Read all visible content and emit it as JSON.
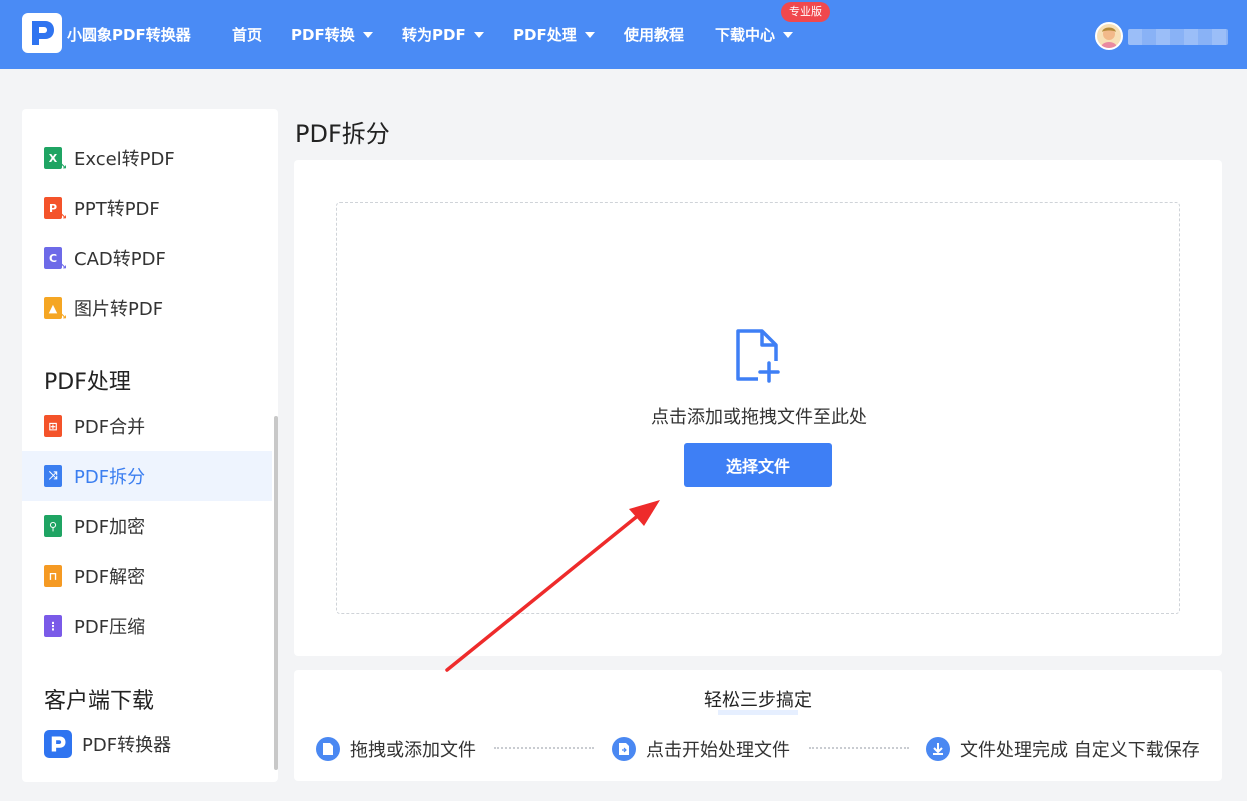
{
  "header": {
    "app_name": "小圆象PDF转换器",
    "nav": [
      "首页",
      "PDF转换",
      "转为PDF",
      "PDF处理",
      "使用教程",
      "下载中心"
    ],
    "pro_badge": "专业版",
    "bg_color": "#4a8bf5"
  },
  "sidebar": {
    "convert_items": [
      {
        "label": "Excel转PDF",
        "icon": "excel-icon",
        "icon_letter": "X",
        "color": "#1fa463"
      },
      {
        "label": "PPT转PDF",
        "icon": "ppt-icon",
        "icon_letter": "P",
        "color": "#f4532a"
      },
      {
        "label": "CAD转PDF",
        "icon": "cad-icon",
        "icon_letter": "C",
        "color": "#6d6ae8"
      },
      {
        "label": "图片转PDF",
        "icon": "image-icon",
        "icon_letter": "",
        "color": "#f5a623"
      }
    ],
    "pdf_section_title": "PDF处理",
    "pdf_items": [
      {
        "label": "PDF合并",
        "icon": "merge-icon",
        "color": "#f4532a"
      },
      {
        "label": "PDF拆分",
        "icon": "split-icon",
        "color": "#3b7ef0",
        "active": true
      },
      {
        "label": "PDF加密",
        "icon": "encrypt-icon",
        "color": "#1fa463"
      },
      {
        "label": "PDF解密",
        "icon": "decrypt-icon",
        "color": "#f59a23"
      },
      {
        "label": "PDF压缩",
        "icon": "compress-icon",
        "color": "#7a5ae8"
      }
    ],
    "client_section_title": "客户端下载",
    "client_item": {
      "label": "PDF转换器",
      "icon": "app-logo-icon"
    }
  },
  "main": {
    "title": "PDF拆分",
    "drop_hint": "点击添加或拖拽文件至此处",
    "select_button": "选择文件",
    "accent_color": "#3e7ff5"
  },
  "steps": {
    "title": "轻松三步搞定",
    "items": [
      {
        "label": "拖拽或添加文件",
        "icon": "file-icon"
      },
      {
        "label": "点击开始处理文件",
        "icon": "process-icon"
      },
      {
        "label": "文件处理完成 自定义下载保存",
        "icon": "download-icon"
      }
    ]
  }
}
